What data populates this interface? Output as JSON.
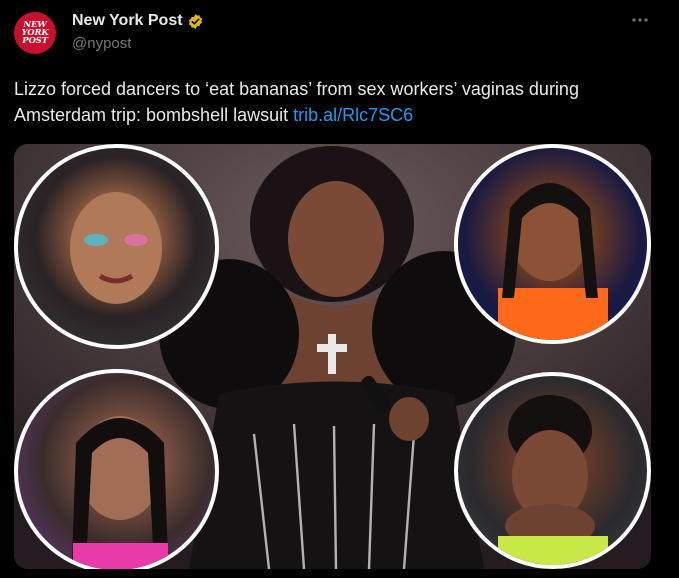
{
  "account": {
    "logo_text": "NEW\nYORK\nPOST",
    "display_name": "New York Post",
    "handle": "@nypost",
    "verified_icon": "verified-badge-gold-icon",
    "more_icon": "more-dots-icon"
  },
  "tweet": {
    "text": "Lizzo forced dancers to ‘eat bananas’ from sex workers’ vaginas during Amsterdam trip: bombshell lawsuit ",
    "link": "trib.al/Rlc7SC6"
  },
  "colors": {
    "background": "#000000",
    "text": "#e7e9ea",
    "secondary": "#71767b",
    "link": "#1d9bf0",
    "logo_red": "#c8102e",
    "verified_gold": "#e2b719"
  }
}
